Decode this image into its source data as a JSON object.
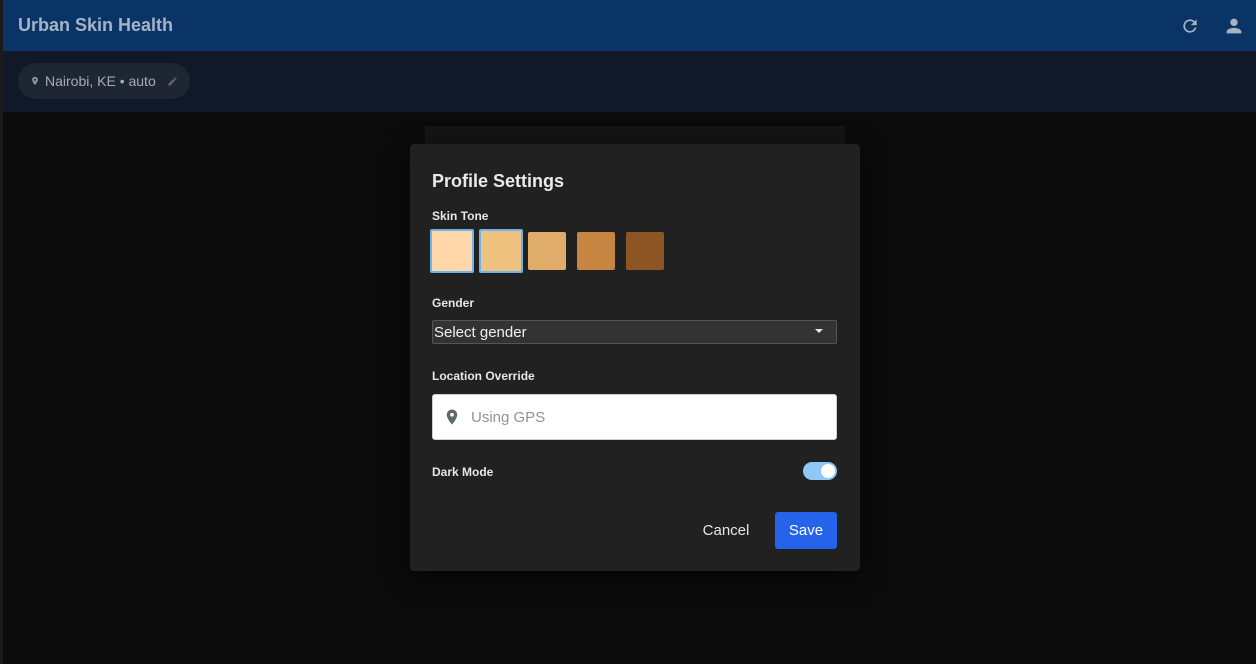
{
  "app": {
    "title": "Urban Skin Health"
  },
  "topbar": {
    "refresh_icon": "refresh-icon",
    "account_icon": "person-icon"
  },
  "location_chip": {
    "text": "Nairobi, KE • auto",
    "pin_icon": "map-pin-icon",
    "edit_icon": "pencil-icon"
  },
  "modal": {
    "title": "Profile Settings",
    "skin_tone": {
      "label": "Skin Tone",
      "swatches": [
        {
          "color": "#FFD7A8",
          "selected": true
        },
        {
          "color": "#F0C27F",
          "selected": true
        },
        {
          "color": "#E0AC69",
          "selected": false
        },
        {
          "color": "#C68642",
          "selected": false
        },
        {
          "color": "#8D5524",
          "selected": false
        }
      ]
    },
    "gender": {
      "label": "Gender",
      "value": "Select gender"
    },
    "location_override": {
      "label": "Location Override",
      "placeholder": "Using GPS",
      "value": ""
    },
    "dark_mode": {
      "label": "Dark Mode",
      "on": true
    },
    "actions": {
      "cancel": "Cancel",
      "save": "Save"
    }
  },
  "colors": {
    "topbar": "#0A3466",
    "modal_bg": "#212121",
    "primary": "#2563EB",
    "toggle_on": "#8EC8F6"
  }
}
